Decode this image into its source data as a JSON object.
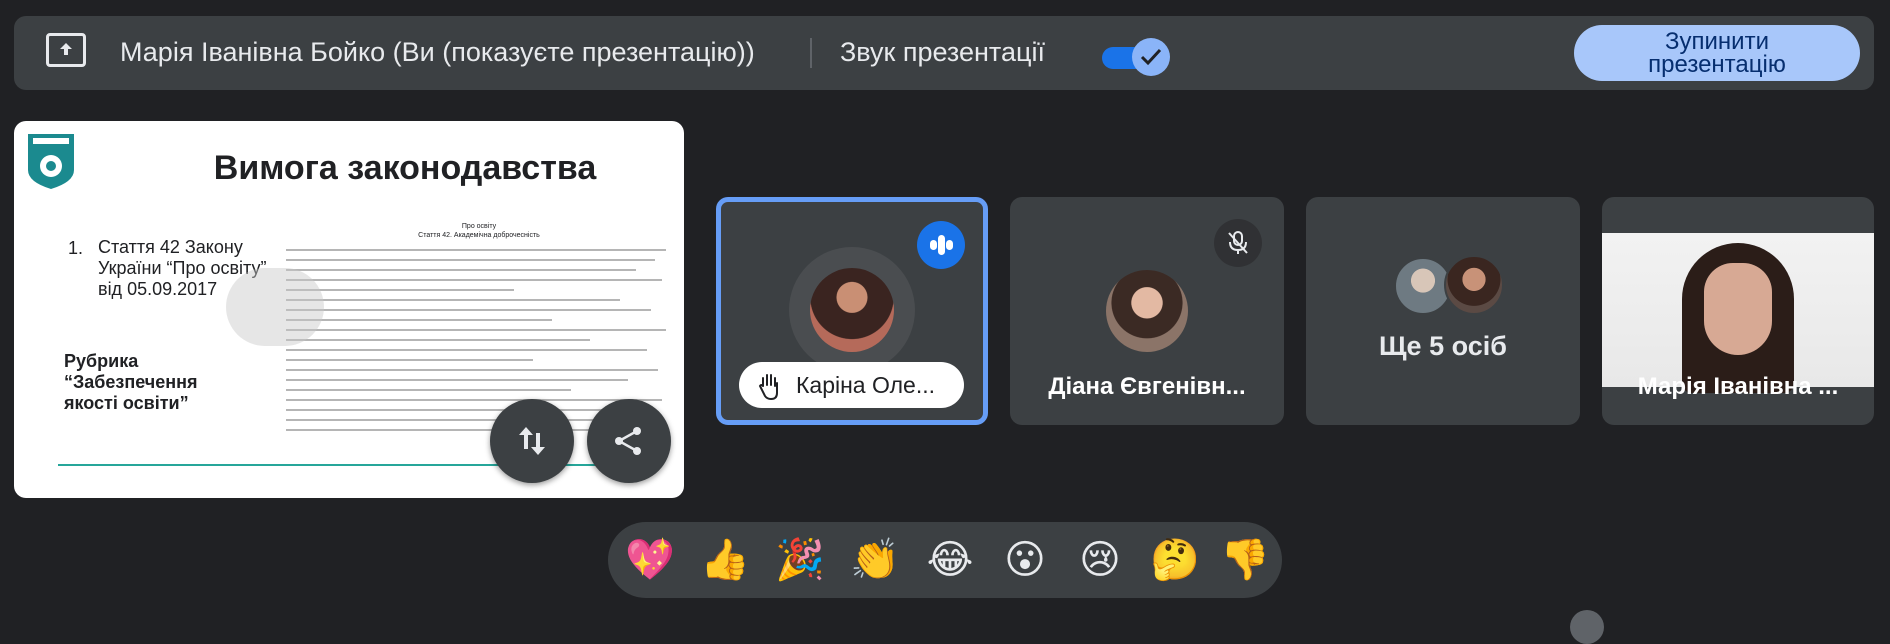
{
  "topbar": {
    "presenter_name": "Марія Іванівна Бойко (Ви (показуєте презентацію))",
    "sound_label": "Звук презентації",
    "sound_enabled": true,
    "stop_button": "Зупинити\nпрезентацію"
  },
  "slide": {
    "title": "Вимога законодавства",
    "item_number": "1.",
    "item_text": "Стаття 42 Закону України “Про освіту” від 05.09.2017",
    "rubric": "Рубрика “Забезпечення якості освіти”",
    "doc_title": "Про освіту\nСтаття 42. Академічна доброчесність"
  },
  "participants": [
    {
      "name": "Каріна Оле...",
      "state": "speaking",
      "hand_raised": true
    },
    {
      "name": "Діана Євгенівн...",
      "state": "muted"
    },
    {
      "name": "Ще 5 осіб",
      "state": "group"
    },
    {
      "name": "Марія Іванівна ...",
      "state": "video"
    }
  ],
  "reactions": [
    "💖",
    "👍",
    "🎉",
    "👏",
    "😂",
    "😮",
    "😢",
    "🤔",
    "👎"
  ],
  "colors": {
    "background": "#202124",
    "surface": "#3c4043",
    "accent": "#1a73e8",
    "active_border": "#669df6",
    "stop_button": "#a8c7fa"
  }
}
